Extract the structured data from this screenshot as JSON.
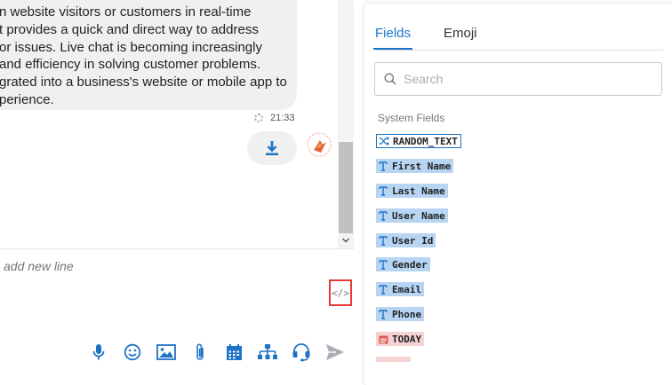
{
  "chat": {
    "message_lines": [
      "n website visitors or customers in real-time",
      "t provides a quick and direct way to address",
      "or issues. Live chat is becoming increasingly",
      "and efficiency in solving customer problems.",
      "grated into a business's website or mobile app to",
      "perience."
    ],
    "message_time": "21:33",
    "composer_placeholder": "add new line",
    "code_toggle_label": "</>",
    "toolbar_icons": [
      "microphone-icon",
      "emoji-icon",
      "image-icon",
      "attachment-icon",
      "calendar-icon",
      "sitemap-icon",
      "headset-icon",
      "send-icon"
    ]
  },
  "panel": {
    "tabs": [
      {
        "label": "Fields",
        "active": true
      },
      {
        "label": "Emoji",
        "active": false
      }
    ],
    "search_placeholder": "Search",
    "section_label": "System Fields",
    "fields": [
      {
        "label": "RANDOM_TEXT",
        "icon": "shuffle-icon",
        "style": "outlined"
      },
      {
        "label": "First Name",
        "icon": "text-type-icon",
        "style": "text"
      },
      {
        "label": "Last Name",
        "icon": "text-type-icon",
        "style": "text"
      },
      {
        "label": "User Name",
        "icon": "text-type-icon",
        "style": "text"
      },
      {
        "label": "User Id",
        "icon": "text-type-icon",
        "style": "text"
      },
      {
        "label": "Gender",
        "icon": "text-type-icon",
        "style": "text"
      },
      {
        "label": "Email",
        "icon": "text-type-icon",
        "style": "text"
      },
      {
        "label": "Phone",
        "icon": "text-type-icon",
        "style": "text"
      },
      {
        "label": "TODAY",
        "icon": "calendar-icon",
        "style": "date"
      },
      {
        "label": "",
        "icon": "",
        "style": "date"
      }
    ]
  },
  "colors": {
    "accent": "#1a73c9",
    "chip_text_bg": "#b7d4f3",
    "chip_date_bg": "#f6d3d3",
    "chip_outline": "#1a73c9",
    "highlight_border": "#e53935",
    "icon_blue": "#1f73c7"
  }
}
